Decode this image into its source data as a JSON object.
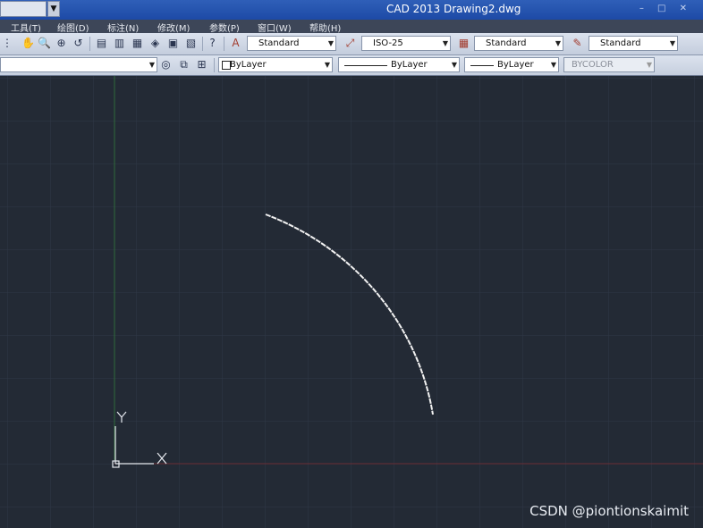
{
  "window": {
    "title": "CAD 2013  Drawing2.dwg",
    "controls": "– □ ✕"
  },
  "menus": [
    "工具(T)",
    "绘图(D)",
    "标注(N)",
    "修改(M)",
    "参数(P)",
    "窗口(W)",
    "帮助(H)"
  ],
  "styles_toolbar": {
    "text_style": "Standard",
    "dim_style": "ISO-25",
    "table_style": "Standard",
    "multileader_style": "Standard"
  },
  "properties_toolbar": {
    "layer": "",
    "color": "ByLayer",
    "linetype": "ByLayer",
    "lineweight": "ByLayer",
    "plot_style": "BYCOLOR"
  },
  "canvas": {
    "background": "#232a35",
    "grid_color": "#2f3847",
    "arc_color": "#f2f2f2",
    "y_axis_color": "#2f6b3a",
    "x_axis_color": "#6b2d35",
    "ucs_y_label": "Y",
    "ucs_x_label": "X"
  },
  "watermark": "CSDN @piontionskaimit"
}
